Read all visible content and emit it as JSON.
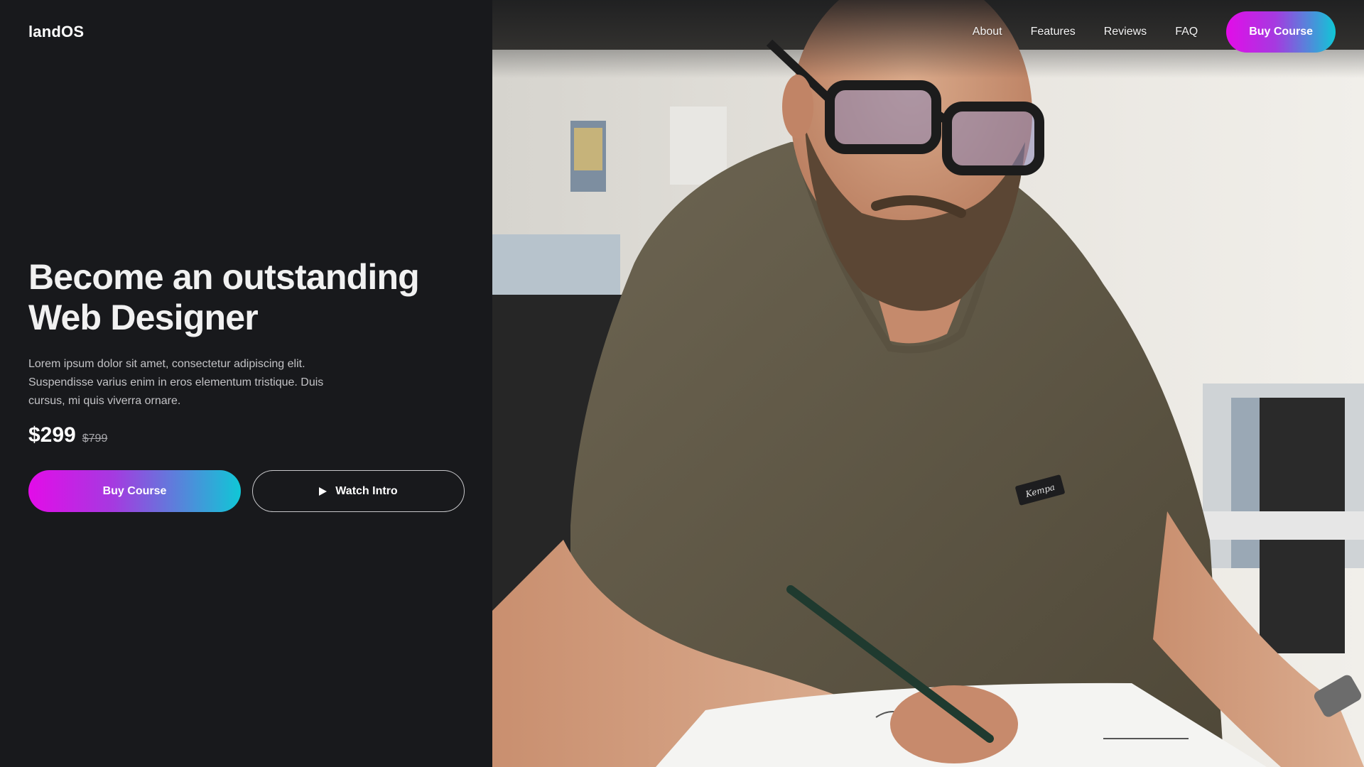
{
  "brand": {
    "name": "landOS"
  },
  "nav": {
    "links": [
      "About",
      "Features",
      "Reviews",
      "FAQ"
    ],
    "cta_label": "Buy Course"
  },
  "hero": {
    "title_line1": "Become an outstanding",
    "title_line2": "Web Designer",
    "description": "Lorem ipsum dolor sit amet, consectetur adipiscing elit. Suspendisse varius enim in eros elementum tristique. Duis cursus, mi quis viverra ornare.",
    "price_current": "$299",
    "price_original": "$799",
    "buy_label": "Buy Course",
    "watch_label": "Watch Intro"
  },
  "photo": {
    "subject": "man with glasses and beard sketching at desk",
    "shirt_badge": "Kempa"
  },
  "colors": {
    "background": "#18191c",
    "gradient_start": "#e30ce8",
    "gradient_end": "#10c7d6",
    "text_primary": "#f1f1f1",
    "text_muted": "#c3c3c6"
  },
  "icons": {
    "play": "play-icon"
  }
}
